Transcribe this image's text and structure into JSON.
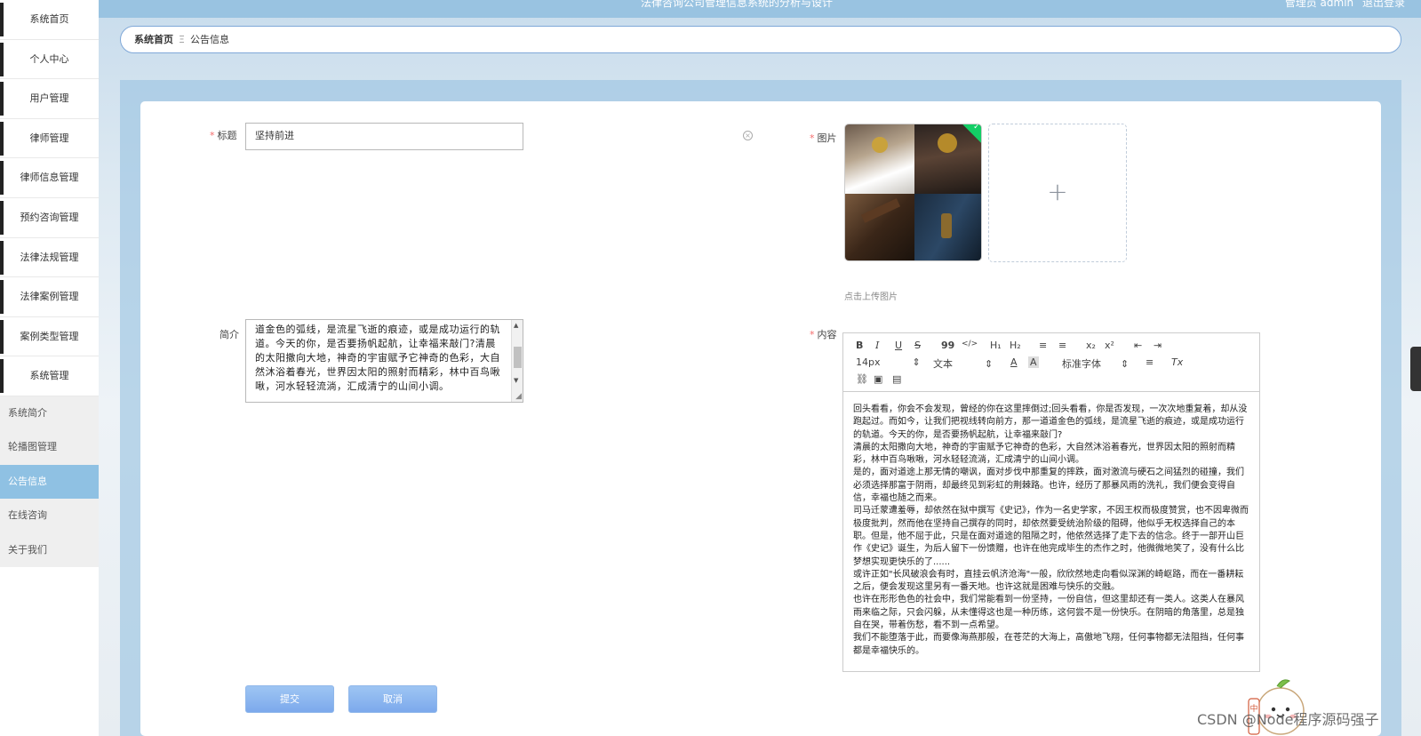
{
  "header": {
    "title": "法律咨询公司管理信息系统的分析与设计",
    "user_label": "管理员 admin",
    "logout_label": "退出登录"
  },
  "sidebar": {
    "items": [
      {
        "label": "系统首页"
      },
      {
        "label": "个人中心"
      },
      {
        "label": "用户管理"
      },
      {
        "label": "律师管理"
      },
      {
        "label": "律师信息管理"
      },
      {
        "label": "预约咨询管理"
      },
      {
        "label": "法律法规管理"
      },
      {
        "label": "法律案例管理"
      },
      {
        "label": "案例类型管理"
      },
      {
        "label": "系统管理"
      }
    ],
    "sub_items": [
      {
        "label": "系统简介"
      },
      {
        "label": "轮播图管理"
      },
      {
        "label": "公告信息"
      },
      {
        "label": "在线咨询"
      },
      {
        "label": "关于我们"
      }
    ]
  },
  "breadcrumb": {
    "home": "系统首页",
    "separator": "Ξ",
    "current": "公告信息"
  },
  "form": {
    "title_label": "标题",
    "title_value": "坚持前进",
    "summary_label": "简介",
    "summary_value": "道金色的弧线，是流星飞逝的痕迹，或是成功运行的轨道。今天的你，是否要扬帆起航，让幸福来敲门?清晨的太阳撒向大地，神奇的宇宙赋予它神奇的色彩，大自然沐浴着春光，世界因太阳的照射而精彩，林中百鸟啾啾，河水轻轻流淌，汇成清宁的山间小调。",
    "image_label": "图片",
    "image_tip": "点击上传图片",
    "content_label": "内容",
    "submit_label": "提交",
    "cancel_label": "取消"
  },
  "editor": {
    "toolbar": {
      "bold": "B",
      "italic": "I",
      "underline": "U",
      "strike": "S",
      "quote": "99",
      "code": "</>",
      "h1": "H₁",
      "h2": "H₂",
      "ol": "≡",
      "ul": "≡",
      "sub": "x₂",
      "sup": "x²",
      "outdent": "⇤",
      "indent": "⇥",
      "size": "14px",
      "format": "文本",
      "font": "标准字体",
      "align": "≡",
      "clear": "Tx"
    },
    "paragraphs": [
      "回头看看，你会不会发现，曾经的你在这里摔倒过;回头看看，你是否发现，一次次地重复着，却从没跑起过。而如今，让我们把视线转向前方，那一道道金色的弧线，是流星飞逝的痕迹，或是成功运行的轨道。今天的你，是否要扬帆起航，让幸福来敲门?",
      "清晨的太阳撒向大地，神奇的宇宙赋予它神奇的色彩，大自然沐浴着春光，世界因太阳的照射而精彩，林中百鸟啾啾，河水轻轻流淌，汇成清宁的山间小调。",
      "是的，面对道途上那无情的嘲讽，面对步伐中那重复的摔跌，面对激流与硬石之间猛烈的碰撞，我们必须选择那富于阴雨，却最终见到彩虹的荆棘路。也许，经历了那暴风雨的洗礼，我们便会变得自信，幸福也随之而来。",
      "司马迁蒙遭羞辱，却依然在狱中撰写《史记》，作为一名史学家，不因王权而极度赞赏，也不因卑微而极度批判，然而他在坚持自己撰存的同时，却依然要受统治阶级的阻碍，他似乎无权选择自己的本职。但是，他不屈于此，只是在面对道途的阻隔之时，他依然选择了走下去的信念。终于一部开山巨作《史记》诞生，为后人留下一份馈赠，也许在他完成毕生的杰作之时，他微微地笑了，没有什么比梦想实现更快乐的了......",
      "或许正如\"长风破浪会有时，直挂云帆济沧海\"一般，欣欣然地走向看似深渊的崎岖路，而在一番耕耘之后，便会发现这里另有一番天地。也许这就是困难与快乐的交融。",
      "也许在形形色色的社会中，我们常能看到一份坚持，一份自信，但这里却还有一类人。这类人在暴风雨来临之际，只会闪躲，从未懂得这也是一种历练，这何尝不是一份快乐。在阴暗的角落里，总是独自在哭，带着伤愁，看不到一点希望。",
      "我们不能堕落于此，而要像海燕那般，在苍茫的大海上，高傲地飞翔，任何事物都无法阻挡，任何事都是幸福快乐的。"
    ]
  },
  "watermark": "CSDN @Node程序源码强子",
  "colors": {
    "sidebar_active": "#8fc1e3",
    "topbar": "#99c3e1",
    "button": "#7ca9ec",
    "required": "#f56c6c"
  }
}
